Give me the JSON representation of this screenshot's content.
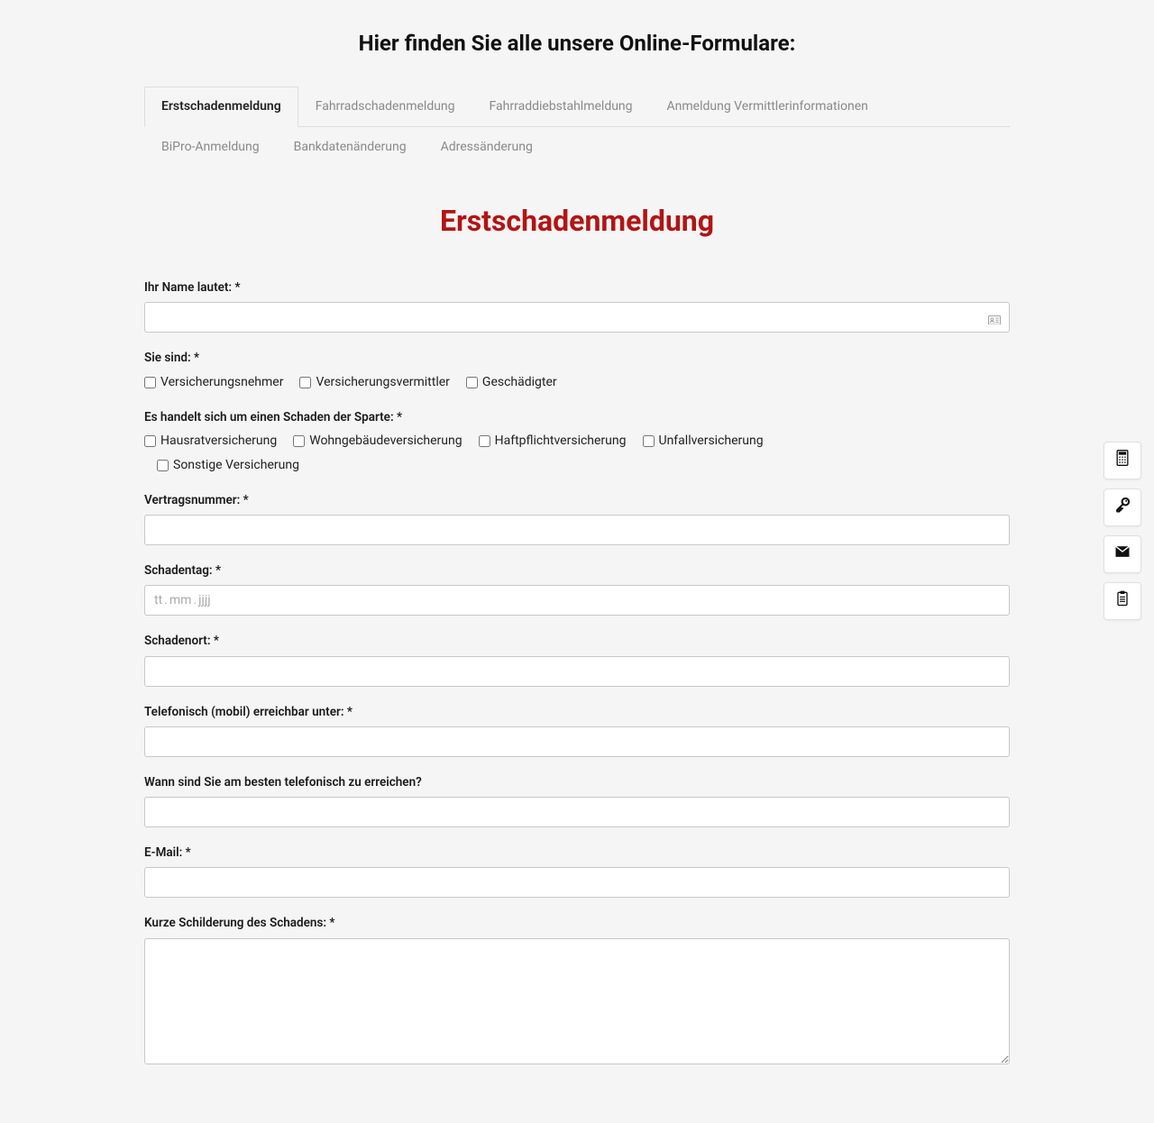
{
  "pageTitle": "Hier finden Sie alle unsere Online-Formulare:",
  "tabs": {
    "row1": [
      "Erstschadenmeldung",
      "Fahrradschadenmeldung",
      "Fahrraddiebstahlmeldung",
      "Anmeldung Vermittlerinformationen"
    ],
    "row2": [
      "BiPro-Anmeldung",
      "Bankdatenänderung",
      "Adressänderung"
    ],
    "active": "Erstschadenmeldung"
  },
  "formHeading": "Erstschadenmeldung",
  "labels": {
    "name": "Ihr Name lautet: *",
    "youAre": "Sie sind: *",
    "sparte": "Es handelt sich um einen Schaden der Sparte: *",
    "vertragsnummer": "Vertragsnummer: *",
    "schadentag": "Schadentag: *",
    "schadenort": "Schadenort: *",
    "telefon": "Telefonisch (mobil) erreichbar unter: *",
    "wannErreichen": "Wann sind Sie am besten telefonisch zu erreichen?",
    "email": "E-Mail: *",
    "schilderung": "Kurze Schilderung des Schadens: *"
  },
  "placeholders": {
    "date_tt": "tt",
    "date_mm": "mm",
    "date_jjjj": "jjjj"
  },
  "checkboxes": {
    "youAre": [
      "Versicherungsnehmer",
      "Versicherungsvermittler",
      "Geschädigter"
    ],
    "sparte": [
      "Hausratversicherung",
      "Wohngebäudeversicherung",
      "Haftpflichtversicherung",
      "Unfallversicherung",
      "Sonstige Versicherung"
    ]
  },
  "floatButtons": [
    "calculator-icon",
    "key-icon",
    "mail-icon",
    "clipboard-icon"
  ]
}
